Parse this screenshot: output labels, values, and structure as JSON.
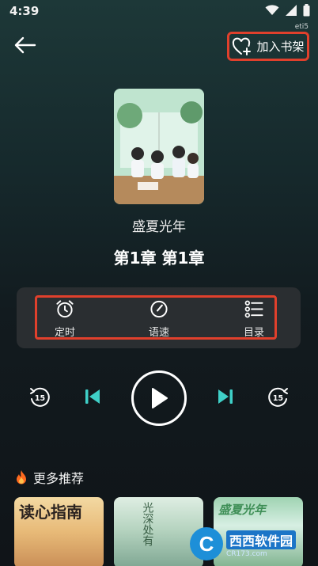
{
  "status_bar": {
    "time": "4:39"
  },
  "corner_label": "eti5",
  "header": {
    "add_to_shelf_label": "加入书架"
  },
  "book": {
    "title": "盛夏光年",
    "chapter": "第1章  第1章"
  },
  "toolbar": {
    "timer_label": "定时",
    "speed_label": "语速",
    "catalog_label": "目录"
  },
  "player": {
    "rewind_seconds": "15",
    "forward_seconds": "15"
  },
  "recommendations": {
    "section_title": "更多推荐",
    "cards": [
      {
        "cover_text": "读心指南"
      },
      {
        "cover_text": "光深处有"
      },
      {
        "cover_text": "盛夏光年"
      }
    ]
  },
  "watermark": {
    "main": "西西软件园",
    "sub": "CR173.com"
  },
  "colors": {
    "highlight": "#e0402c",
    "accent": "#3fd0c8"
  }
}
